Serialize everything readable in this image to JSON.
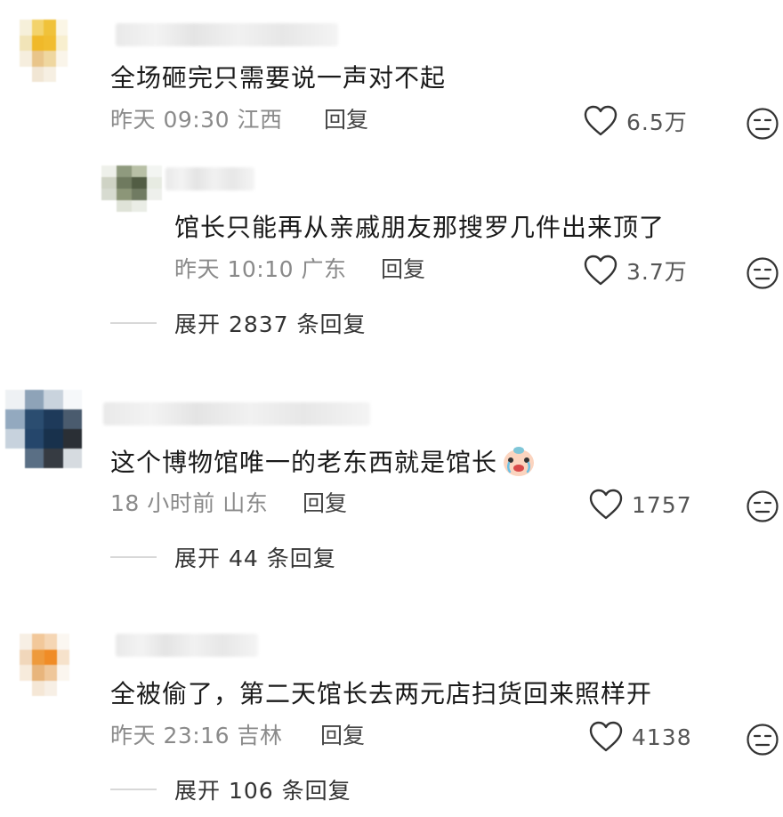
{
  "comments": [
    {
      "text": "全场砸完只需要说一声对不起",
      "time": "昨天 09:30",
      "location": "江西",
      "reply_label": "回复",
      "likes": "6.5万",
      "reply": {
        "text": "馆长只能再从亲戚朋友那搜罗几件出来顶了",
        "time": "昨天 10:10",
        "location": "广东",
        "reply_label": "回复",
        "likes": "3.7万"
      },
      "expand_label": "展开 2837 条回复"
    },
    {
      "text": "这个博物馆唯一的老东西就是馆长",
      "emoji": "crying-face-emoji",
      "time": "18 小时前",
      "location": "山东",
      "reply_label": "回复",
      "likes": "1757",
      "expand_label": "展开 44 条回复"
    },
    {
      "text": "全被偷了，第二天馆长去两元店扫货回来照样开",
      "time": "昨天 23:16",
      "location": "吉林",
      "reply_label": "回复",
      "likes": "4138",
      "expand_label": "展开 106 条回复"
    }
  ],
  "colors": {
    "text": "#1a1a1a",
    "meta": "#8a8a8a",
    "icon": "#333333",
    "divider": "#d8d8d8"
  },
  "icons": {
    "like": "heart-outline-icon",
    "dislike": "neutral-face-icon"
  }
}
